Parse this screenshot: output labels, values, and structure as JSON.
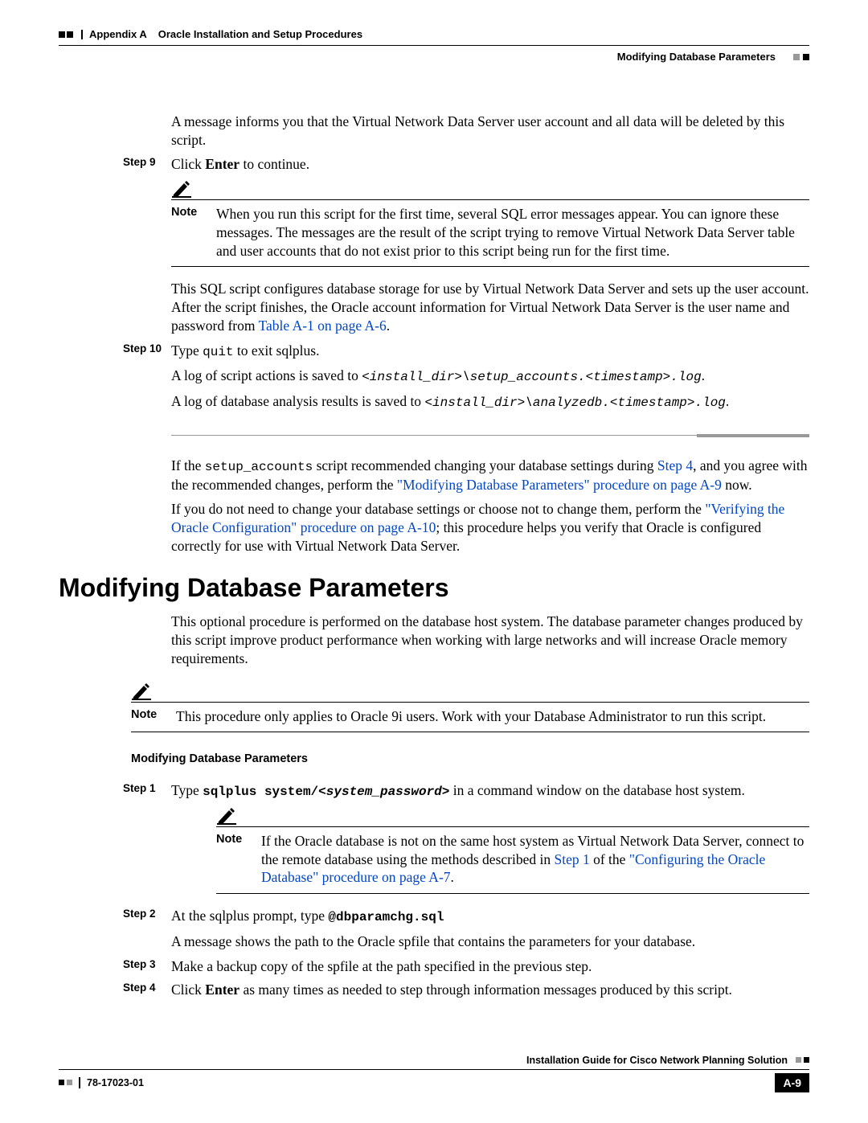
{
  "header": {
    "appendix": "Appendix A",
    "title": "Oracle Installation and Setup Procedures",
    "subhead": "Modifying Database Parameters"
  },
  "intro_para": "A message informs you that the Virtual Network Data Server user account and all data will be deleted by this script.",
  "step9": {
    "label": "Step 9",
    "text_pre": "Click ",
    "bold": "Enter",
    "text_post": " to continue."
  },
  "note1": {
    "label": "Note",
    "text": "When you run this script for the first time, several SQL error messages appear. You can ignore these messages. The messages are the result of the script trying to remove Virtual Network Data Server table and user accounts that do not exist prior to this script being run for the first time."
  },
  "para_sql": {
    "text_pre": "This SQL script configures database storage for use by Virtual Network Data Server and sets up the user account. After the script finishes, the Oracle account information for Virtual Network Data Server is the user name and password from ",
    "link": "Table A-1 on page A-6",
    "text_post": "."
  },
  "step10": {
    "label": "Step 10",
    "text_pre": "Type ",
    "code": "quit",
    "text_post": " to exit sqlplus."
  },
  "log1": {
    "pre": "A log of script actions is saved to ",
    "code": "<install_dir>\\setup_accounts.<timestamp>.log"
  },
  "log2": {
    "pre": "A log of database analysis results is saved to ",
    "code": "<install_dir>\\analyzedb.<timestamp>.log"
  },
  "para_if1": {
    "t1": "If the ",
    "code": "setup_accounts",
    "t2": " script recommended changing your database settings during ",
    "link1": "Step 4",
    "t3": ", and you agree with the recommended changes, perform the ",
    "link2": "\"Modifying Database Parameters\" procedure on page A-9",
    "t4": " now."
  },
  "para_if2": {
    "t1": "If you do not need to change your database settings or choose not to change them, perform the ",
    "link": "\"Verifying the Oracle Configuration\" procedure on page A-10",
    "t2": "; this procedure helps you verify that Oracle is configured correctly for use with Virtual Network Data Server."
  },
  "section": {
    "title": "Modifying Database Parameters",
    "intro": "This optional procedure is performed on the database host system. The database parameter changes produced by this script improve product performance when working with large networks and will increase Oracle memory requirements."
  },
  "note2": {
    "label": "Note",
    "text": "This procedure only applies to Oracle 9i users. Work with your Database Administrator to run this script."
  },
  "subheading": "Modifying Database Parameters",
  "s1": {
    "label": "Step 1",
    "t1": "Type ",
    "code": "sqlplus system/<system_password>",
    "t2": " in a command window on the database host system."
  },
  "note3": {
    "label": "Note",
    "t1": "If the Oracle database is not on the same host system as Virtual Network Data Server, connect to the remote database using the methods described in ",
    "link1": "Step 1",
    "t2": " of the ",
    "link2": "\"Configuring the Oracle Database\" procedure on page A-7",
    "t3": "."
  },
  "s2": {
    "label": "Step 2",
    "t1": "At the sqlplus prompt, type ",
    "code": "@dbparamchg.sql"
  },
  "s2b": "A message shows the path to the Oracle spfile that contains the parameters for your database.",
  "s3": {
    "label": "Step 3",
    "text": "Make a backup copy of the spfile at the path specified in the previous step."
  },
  "s4": {
    "label": "Step 4",
    "t1": "Click ",
    "bold": "Enter",
    "t2": " as many times as needed to step through information messages produced by this script."
  },
  "footer": {
    "title": "Installation Guide for Cisco Network Planning Solution",
    "docnum": "78-17023-01",
    "page": "A-9"
  }
}
